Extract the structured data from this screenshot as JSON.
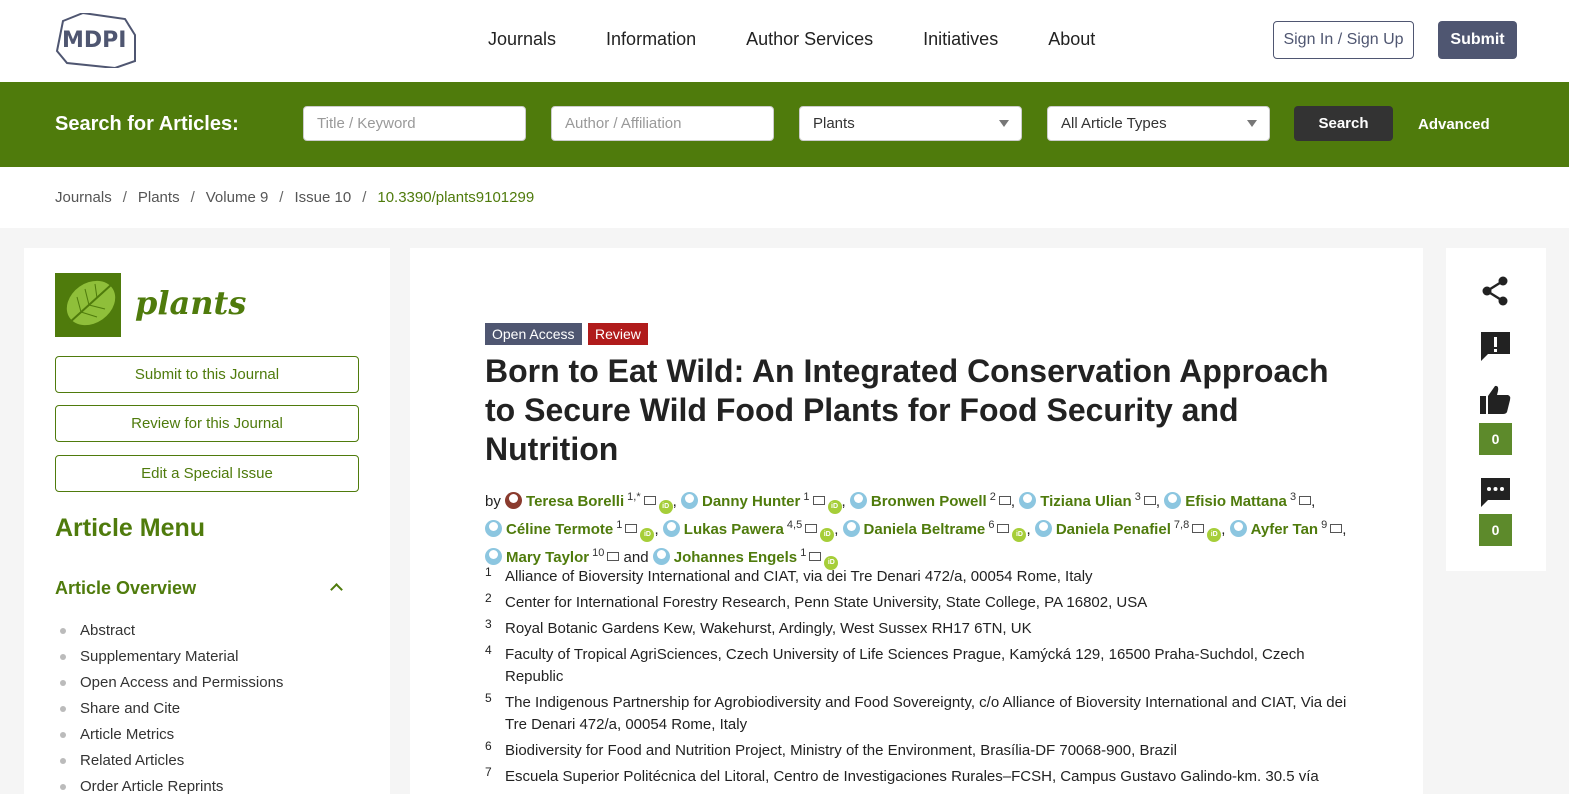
{
  "header": {
    "nav": [
      "Journals",
      "Information",
      "Author Services",
      "Initiatives",
      "About"
    ],
    "signin_label": "Sign In / Sign Up",
    "submit_label": "Submit"
  },
  "search": {
    "label": "Search for Articles:",
    "keyword_placeholder": "Title / Keyword",
    "author_placeholder": "Author / Affiliation",
    "journal_selected": "Plants",
    "type_selected": "All Article Types",
    "search_label": "Search",
    "advanced_label": "Advanced"
  },
  "breadcrumb": [
    "Journals",
    "Plants",
    "Volume 9",
    "Issue 10",
    "10.3390/plants9101299"
  ],
  "sidebar": {
    "journal_name": "plants",
    "buttons": [
      "Submit to this Journal",
      "Review for this Journal",
      "Edit a Special Issue"
    ],
    "menu_title": "Article Menu",
    "overview_title": "Article Overview",
    "menu_items": [
      "Abstract",
      "Supplementary Material",
      "Open Access and Permissions",
      "Share and Cite",
      "Article Metrics",
      "Related Articles",
      "Order Article Reprints"
    ]
  },
  "article": {
    "badges": [
      "Open Access",
      "Review"
    ],
    "title": "Born to Eat Wild: An Integrated Conservation Approach to Secure Wild Food Plants for Food Security and Nutrition",
    "by_label": "by",
    "and_label": "and",
    "authors": [
      {
        "name": "Teresa Borelli",
        "sup": "1,*",
        "orcid": true,
        "photo": true
      },
      {
        "name": "Danny Hunter",
        "sup": "1",
        "orcid": true
      },
      {
        "name": "Bronwen Powell",
        "sup": "2",
        "orcid": false
      },
      {
        "name": "Tiziana Ulian",
        "sup": "3",
        "orcid": false
      },
      {
        "name": "Efisio Mattana",
        "sup": "3",
        "orcid": false
      },
      {
        "name": "Céline Termote",
        "sup": "1",
        "orcid": true
      },
      {
        "name": "Lukas Pawera",
        "sup": "4,5",
        "orcid": true
      },
      {
        "name": "Daniela Beltrame",
        "sup": "6",
        "orcid": true
      },
      {
        "name": "Daniela Penafiel",
        "sup": "7,8",
        "orcid": true
      },
      {
        "name": "Ayfer Tan",
        "sup": "9",
        "orcid": false
      },
      {
        "name": "Mary Taylor",
        "sup": "10",
        "orcid": false
      },
      {
        "name": "Johannes Engels",
        "sup": "1",
        "orcid": true
      }
    ],
    "affiliations": [
      {
        "num": "1",
        "text": "Alliance of Bioversity International and CIAT, via dei Tre Denari 472/a, 00054 Rome, Italy"
      },
      {
        "num": "2",
        "text": "Center for International Forestry Research, Penn State University, State College, PA 16802, USA"
      },
      {
        "num": "3",
        "text": "Royal Botanic Gardens Kew, Wakehurst, Ardingly, West Sussex RH17 6TN, UK"
      },
      {
        "num": "4",
        "text": "Faculty of Tropical AgriSciences, Czech University of Life Sciences Prague, Kamýcká 129, 16500 Praha-Suchdol, Czech Republic"
      },
      {
        "num": "5",
        "text": "The Indigenous Partnership for Agrobiodiversity and Food Sovereignty, c/o Alliance of Bioversity International and CIAT, Via dei Tre Denari 472/a, 00054 Rome, Italy"
      },
      {
        "num": "6",
        "text": "Biodiversity for Food and Nutrition Project, Ministry of the Environment, Brasília-DF 70068-900, Brazil"
      },
      {
        "num": "7",
        "text": "Escuela Superior Politécnica del Litoral, Centro de Investigaciones Rurales–FCSH, Campus Gustavo Galindo-km. 30.5 vía"
      }
    ]
  },
  "right_panel": {
    "icons": [
      "share-icon",
      "alert-icon",
      "thumbs-up-icon",
      "comment-icon"
    ],
    "like_count": "0",
    "comment_count": "0"
  },
  "colors": {
    "brand_green": "#4f7b0c",
    "brand_navy": "#4f5671",
    "review_red": "#b01b1b"
  }
}
